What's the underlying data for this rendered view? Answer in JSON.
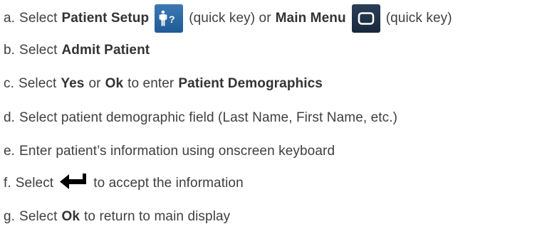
{
  "steps": [
    {
      "letter": "a.",
      "t1": "Select",
      "b1": "Patient Setup",
      "t2": "(quick key) or",
      "b2": "Main Menu",
      "t3": "(quick key)",
      "icon1": "patient-setup-quick-key-icon",
      "icon2": "main-menu-quick-key-icon"
    },
    {
      "letter": "b.",
      "t1": "Select",
      "b1": "Admit Patient"
    },
    {
      "letter": "c.",
      "t1": "Select",
      "b1": "Yes",
      "t2": "or",
      "b2": "Ok",
      "t3": "to enter",
      "b3": "Patient Demographics"
    },
    {
      "letter": "d.",
      "t1": "Select patient demographic field (Last Name, First Name, etc.)"
    },
    {
      "letter": "e.",
      "t1": "Enter patient’s information using onscreen keyboard"
    },
    {
      "letter": "f.",
      "t1": "Select",
      "t2": "to accept the information",
      "icon1": "enter-arrow-icon"
    },
    {
      "letter": "g.",
      "t1": "Select",
      "b1": "Ok",
      "t2": "to return to main display"
    }
  ],
  "colors": {
    "text": "#3f3f3f",
    "patient_key_bg": "#2f6ca8",
    "menu_key_bg": "#1f3247"
  }
}
